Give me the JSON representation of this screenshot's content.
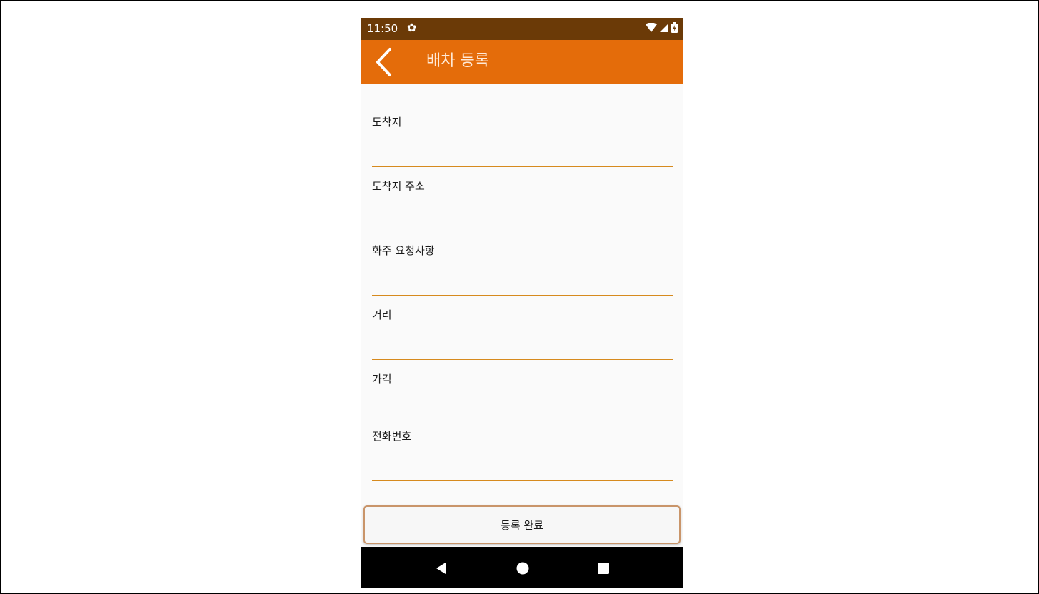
{
  "status_bar": {
    "time": "11:50",
    "settings_icon": "gear-icon",
    "wifi_icon": "wifi-icon",
    "signal_icon": "signal-icon",
    "battery_icon": "battery-charging-icon"
  },
  "app_bar": {
    "back_icon": "chevron-left-icon",
    "title": "배차 등록",
    "color": "#e46c0a"
  },
  "form": {
    "fields": [
      {
        "label": "",
        "value": ""
      },
      {
        "label": "도착지",
        "value": ""
      },
      {
        "label": "도착지 주소",
        "value": ""
      },
      {
        "label": "화주 요청사항",
        "value": ""
      },
      {
        "label": "거리",
        "value": ""
      },
      {
        "label": "가격",
        "value": ""
      },
      {
        "label": "전화번호",
        "value": ""
      }
    ]
  },
  "submit": {
    "label": "등록 완료"
  },
  "nav_bar": {
    "back_icon": "triangle-back-icon",
    "home_icon": "circle-home-icon",
    "recents_icon": "square-recents-icon"
  },
  "colors": {
    "status_bar": "#6b3a07",
    "accent": "#e46c0a",
    "underline": "#d68a1e"
  }
}
